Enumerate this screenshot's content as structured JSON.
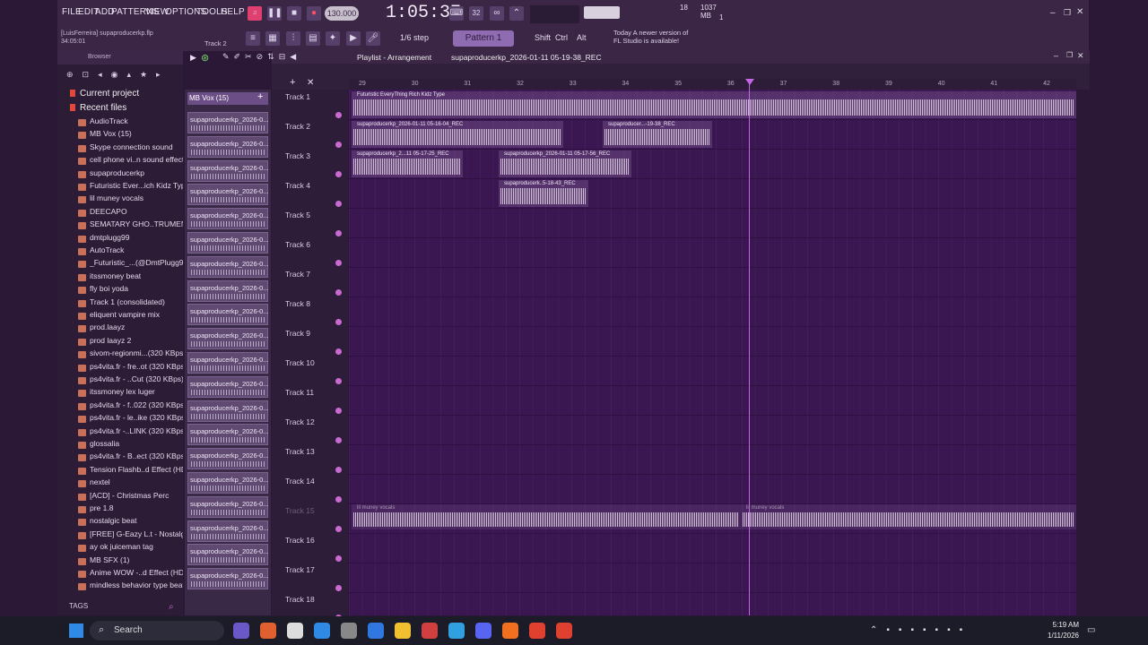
{
  "menu": [
    "FILE",
    "EDIT",
    "ADD",
    "PATTERNS",
    "VIEW",
    "OPTIONS",
    "TOOLS",
    "HELP"
  ],
  "hint_line1": "[LuisFerreira] supaproducerkp.flp",
  "hint_line2": "34:05:01",
  "hint_track": "Track 2",
  "tempo": "130.000",
  "time": "1:05:37",
  "cpu_value": "18",
  "memory": "1037 MB",
  "cpu_voice": "1",
  "snap": "1/6 step",
  "pattern": "Pattern 1",
  "keys": [
    "Shift",
    "Ctrl",
    "Alt"
  ],
  "news_line1": "Today  A newer version of",
  "news_line2": "FL Studio is available!",
  "browser": {
    "title": "Browser",
    "current_files": "Current project",
    "recent_files": "Recent files",
    "items": [
      "AudioTrack",
      "MB Vox (15)",
      "Skype connection sound",
      "cell phone vi..n sound effect",
      "supaproducerkp",
      "Futuristic Ever...ich Kidz Type",
      "lil muney vocals",
      "DEECAPO",
      "SEMATARY GHO..TRUMENTAL",
      "dmtplugg99",
      "AutoTrack",
      "_Futuristic_...(@DmtPlugg99)",
      "itssmoney beat",
      "fly boi yoda",
      "Track 1 (consolidated)",
      "eliquent vampire mix",
      "prod.laayz",
      "prod laayz 2",
      "sivom-regionmi...(320 KBps)",
      "ps4vita.fr - fre..ot (320 KBps)",
      "ps4vita.fr - ..Cut (320 KBps)",
      "itssmoney lex luger",
      "ps4vita.fr - f..022 (320 KBps)",
      "ps4vita.fr - le..ike (320 KBps)",
      "ps4vita.fr -..LINK (320 KBps)",
      "glossalia",
      "ps4vita.fr - B..ect (320 KBps)",
      "Tension Flashb..d Effect (HD)",
      "nextel",
      "[ACD] - Christmas Perc",
      "pre 1.8",
      "nostalgic beat",
      "[FREE] G-Eazy L.t - Nostalgic",
      "ay ok juiceman tag",
      "MB SFX (1)",
      "Anime WOW -..d Effect (HD)",
      "mindless behavior type beat"
    ],
    "tags": "TAGS"
  },
  "picker": {
    "header": "MB Vox (15)",
    "items": [
      "supaproducerkp_2026-0...",
      "supaproducerkp_2026-0...",
      "supaproducerkp_2026-0...",
      "supaproducerkp_2026-0...",
      "supaproducerkp_2026-0...",
      "supaproducerkp_2026-0...",
      "supaproducerkp_2026-0...",
      "supaproducerkp_2026-0...",
      "supaproducerkp_2026-0...",
      "supaproducerkp_2026-0...",
      "supaproducerkp_2026-0...",
      "supaproducerkp_2026-0...",
      "supaproducerkp_2026-0...",
      "supaproducerkp_2026-0...",
      "supaproducerkp_2026-0...",
      "supaproducerkp_2026-0...",
      "supaproducerkp_2026-0...",
      "supaproducerkp_2026-0...",
      "supaproducerkp_2026-0...",
      "supaproducerkp_2026-0..."
    ]
  },
  "playlist": {
    "title": "Playlist - Arrangement",
    "file": "supaproducerkp_2026-01-11 05-19-38_REC",
    "tracks": [
      "Track 1",
      "Track 2",
      "Track 3",
      "Track 4",
      "Track 5",
      "Track 6",
      "Track 7",
      "Track 8",
      "Track 9",
      "Track 10",
      "Track 11",
      "Track 12",
      "Track 13",
      "Track 14",
      "Track 15",
      "Track 16",
      "Track 17",
      "Track 18"
    ],
    "ruler": [
      "29",
      "30",
      "31",
      "32",
      "33",
      "34",
      "35",
      "36",
      "37",
      "38",
      "39",
      "40",
      "41",
      "42"
    ],
    "clips": [
      {
        "label": "Futuristic EveryThing Rich Kidz Type"
      },
      {
        "label": "supaproducerkp_2026-01-11 05-16-04_REC"
      },
      {
        "label": "supaproducer...-19-38_REC"
      },
      {
        "label": "supaproducerkp_2...11 05-17-25_REC"
      },
      {
        "label": "supaproducerkp_2026-01-11 05-17-56_REC"
      },
      {
        "label": "supaproducerk..5-18-43_REC"
      },
      {
        "label": "lil muney vocals"
      },
      {
        "label": "lil muney vocals"
      }
    ]
  },
  "taskbar": {
    "search": "Search",
    "time": "5:19 AM",
    "date": "1/11/2026"
  }
}
